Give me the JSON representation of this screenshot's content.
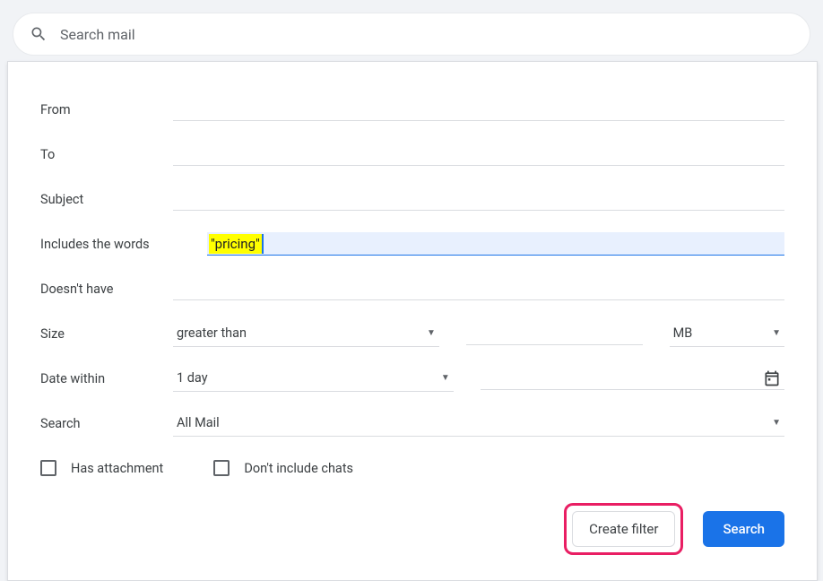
{
  "search": {
    "placeholder": "Search mail"
  },
  "fields": {
    "from": {
      "label": "From",
      "value": ""
    },
    "to": {
      "label": "To",
      "value": ""
    },
    "subject": {
      "label": "Subject",
      "value": ""
    },
    "includes": {
      "label": "Includes the words",
      "value": "\"pricing\""
    },
    "doesnt_have": {
      "label": "Doesn't have",
      "value": ""
    },
    "size": {
      "label": "Size",
      "operator": "greater than",
      "unit": "MB",
      "value": ""
    },
    "date_within": {
      "label": "Date within",
      "range": "1 day",
      "date": ""
    },
    "search_in": {
      "label": "Search",
      "scope": "All Mail"
    }
  },
  "checks": {
    "has_attachment": "Has attachment",
    "exclude_chats": "Don't include chats"
  },
  "buttons": {
    "create_filter": "Create filter",
    "search": "Search"
  }
}
